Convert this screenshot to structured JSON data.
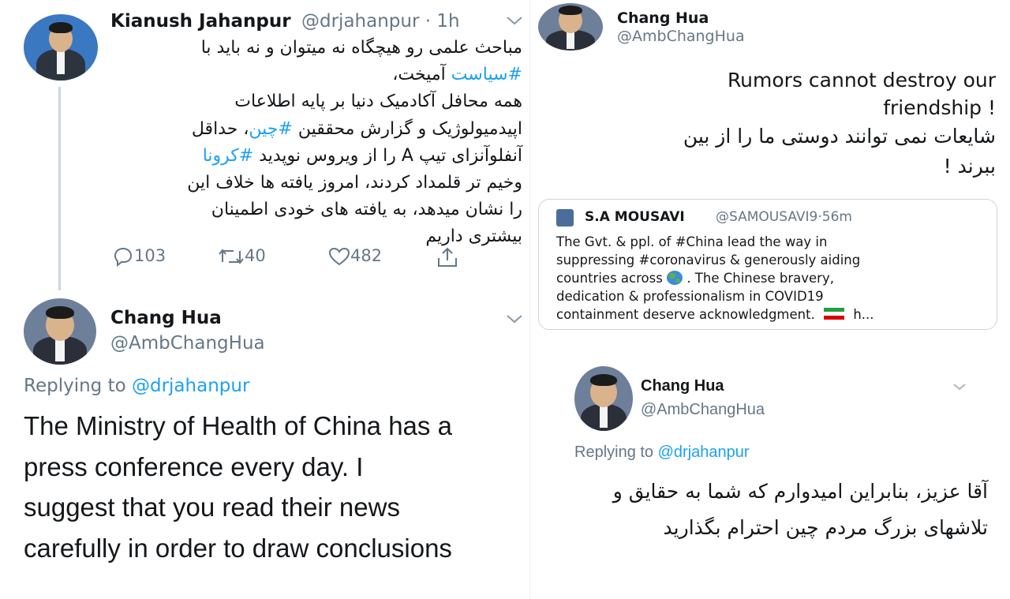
{
  "left": {
    "tweet1": {
      "name": "Kianush Jahanpur",
      "handle": "@drjahanpur",
      "sep": "·",
      "time": "1h",
      "lines": [
        "مباحث علمی رو هیچگاه نه میتوان و نه باید با",
        [
          "#سیاست",
          " آمیخت،"
        ],
        "همه محافل آکادمیک دنیا بر پایه اطلاعات",
        [
          "اپیدمیولوژیک و گزارش محققین ",
          "#چین",
          "، حداقل"
        ],
        [
          "آنفلوآنزای تیپ A را از ویروس نوپدید ",
          "#کرونا"
        ],
        "وخیم تر قلمداد کردند، امروز یافته ها خلاف این",
        "را نشان میدهد، به یافته های خودی اطمینان",
        "بیشتری داریم"
      ],
      "replies": "103",
      "retweets": "40",
      "likes": "482"
    },
    "tweet2": {
      "name": "Chang Hua",
      "handle": "@AmbChangHua",
      "replying_prefix": "Replying to ",
      "replying_to": "@drjahanpur",
      "lines": [
        "The Ministry of Health of China has a",
        "press conference every day. I",
        "suggest that you read their news",
        "carefully in order to draw conclusions"
      ]
    }
  },
  "right": {
    "tweet3": {
      "name": "Chang Hua",
      "handle": "@AmbChangHua",
      "lines_en": [
        "Rumors cannot destroy our",
        "!  friendship"
      ],
      "lines_fa": [
        "شایعات نمی توانند دوستی ما را از بین",
        "ببرند  !"
      ],
      "quote": {
        "name": "S.A MOUSAVI",
        "handle": "@SAMOUSAVI9",
        "sep": "·",
        "time": "56m",
        "lines": [
          "The Gvt. & ppl. of #China lead the way in",
          "suppressing #coronavirus & generously aiding",
          "countries across",
          ". The Chinese bravery,",
          "dedication & professionalism in COVID19",
          "containment deserve acknowledgment.",
          "h..."
        ]
      }
    },
    "tweet4": {
      "name": "Chang Hua",
      "handle": "@AmbChangHua",
      "replying_prefix": "Replying to ",
      "replying_to": "@drjahanpur",
      "lines": [
        "آقا عزیز، بنابراین امیدوارم که شما به حقایق و",
        "تلاشهای بزرگ مردم چین احترام بگذارید"
      ]
    }
  },
  "colors": {
    "link": "#1da1f2",
    "muted": "#657786",
    "text": "#14171a"
  },
  "icons": [
    "reply-icon",
    "retweet-icon",
    "like-icon",
    "share-icon",
    "chevron-down-icon",
    "globe-icon",
    "iran-flag-icon"
  ]
}
